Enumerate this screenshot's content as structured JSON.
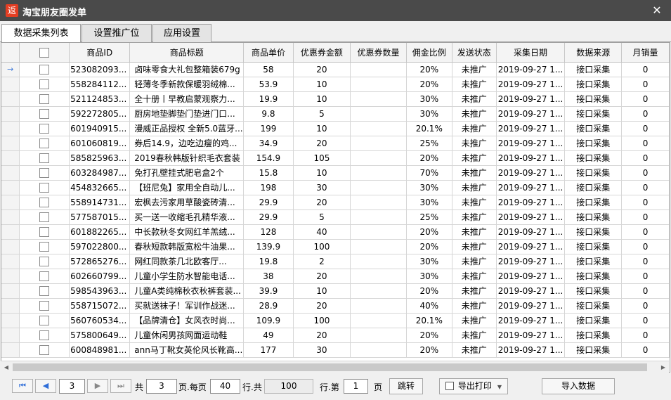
{
  "window": {
    "title": "淘宝朋友圈发单",
    "icon_text": "返",
    "close_symbol": "✕",
    "icon": "app-logo-icon"
  },
  "tabs": [
    {
      "label": "数据采集列表",
      "active": true
    },
    {
      "label": "设置推广位",
      "active": false
    },
    {
      "label": "应用设置",
      "active": false
    }
  ],
  "table": {
    "columns": [
      "商品ID",
      "商品标题",
      "商品单价",
      "优惠券金额",
      "优惠券数量",
      "佣金比例",
      "发送状态",
      "采集日期",
      "数据来源",
      "月销量"
    ],
    "current_row_marker": "→",
    "rows": [
      {
        "id": "523082093...",
        "title": "卤味零食大礼包整箱装679g",
        "price": "58",
        "coupon": "20",
        "coupon_count": "",
        "commission": "20%",
        "status": "未推广",
        "date": "2019-09-27 1...",
        "source": "接口采集",
        "sales": "0"
      },
      {
        "id": "558284112...",
        "title": "轻薄冬季新款保暖羽绒棉...",
        "price": "53.9",
        "coupon": "10",
        "coupon_count": "",
        "commission": "20%",
        "status": "未推广",
        "date": "2019-09-27 1...",
        "source": "接口采集",
        "sales": "0"
      },
      {
        "id": "521124853...",
        "title": "全十册丨早教启蒙观察力...",
        "price": "19.9",
        "coupon": "10",
        "coupon_count": "",
        "commission": "30%",
        "status": "未推广",
        "date": "2019-09-27 1...",
        "source": "接口采集",
        "sales": "0"
      },
      {
        "id": "592272805...",
        "title": "厨房地垫脚垫门垫进门口...",
        "price": "9.8",
        "coupon": "5",
        "coupon_count": "",
        "commission": "30%",
        "status": "未推广",
        "date": "2019-09-27 1...",
        "source": "接口采集",
        "sales": "0"
      },
      {
        "id": "601940915...",
        "title": "漫威正品授权 全新5.0蓝牙...",
        "price": "199",
        "coupon": "10",
        "coupon_count": "",
        "commission": "20.1%",
        "status": "未推广",
        "date": "2019-09-27 1...",
        "source": "接口采集",
        "sales": "0"
      },
      {
        "id": "601060819...",
        "title": "券后14.9，边吃边瘦的鸡...",
        "price": "34.9",
        "coupon": "20",
        "coupon_count": "",
        "commission": "25%",
        "status": "未推广",
        "date": "2019-09-27 1...",
        "source": "接口采集",
        "sales": "0"
      },
      {
        "id": "585825963...",
        "title": "2019春秋韩版针织毛衣套装",
        "price": "154.9",
        "coupon": "105",
        "coupon_count": "",
        "commission": "20%",
        "status": "未推广",
        "date": "2019-09-27 1...",
        "source": "接口采集",
        "sales": "0"
      },
      {
        "id": "603284987...",
        "title": "免打孔壁挂式肥皂盒2个",
        "price": "15.8",
        "coupon": "10",
        "coupon_count": "",
        "commission": "70%",
        "status": "未推广",
        "date": "2019-09-27 1...",
        "source": "接口采集",
        "sales": "0"
      },
      {
        "id": "454832665...",
        "title": "【班尼兔】家用全自动儿...",
        "price": "198",
        "coupon": "30",
        "coupon_count": "",
        "commission": "30%",
        "status": "未推广",
        "date": "2019-09-27 1...",
        "source": "接口采集",
        "sales": "0"
      },
      {
        "id": "558914731...",
        "title": "宏枫去污家用草酸瓷砖清...",
        "price": "29.9",
        "coupon": "20",
        "coupon_count": "",
        "commission": "30%",
        "status": "未推广",
        "date": "2019-09-27 1...",
        "source": "接口采集",
        "sales": "0"
      },
      {
        "id": "577587015...",
        "title": "买一送一收缩毛孔精华液...",
        "price": "29.9",
        "coupon": "5",
        "coupon_count": "",
        "commission": "25%",
        "status": "未推广",
        "date": "2019-09-27 1...",
        "source": "接口采集",
        "sales": "0"
      },
      {
        "id": "601882265...",
        "title": "中长款秋冬女网红羊羔绒...",
        "price": "128",
        "coupon": "40",
        "coupon_count": "",
        "commission": "20%",
        "status": "未推广",
        "date": "2019-09-27 1...",
        "source": "接口采集",
        "sales": "0"
      },
      {
        "id": "597022800...",
        "title": "春秋短款韩版宽松牛油果...",
        "price": "139.9",
        "coupon": "100",
        "coupon_count": "",
        "commission": "20%",
        "status": "未推广",
        "date": "2019-09-27 1...",
        "source": "接口采集",
        "sales": "0"
      },
      {
        "id": "572865276...",
        "title": "网红同款茶几北欧客厅...",
        "price": "19.8",
        "coupon": "2",
        "coupon_count": "",
        "commission": "30%",
        "status": "未推广",
        "date": "2019-09-27 1...",
        "source": "接口采集",
        "sales": "0"
      },
      {
        "id": "602660799...",
        "title": "儿童小学生防水智能电话...",
        "price": "38",
        "coupon": "20",
        "coupon_count": "",
        "commission": "30%",
        "status": "未推广",
        "date": "2019-09-27 1...",
        "source": "接口采集",
        "sales": "0"
      },
      {
        "id": "598543963...",
        "title": "儿童A类纯棉秋衣秋裤套装...",
        "price": "39.9",
        "coupon": "10",
        "coupon_count": "",
        "commission": "20%",
        "status": "未推广",
        "date": "2019-09-27 1...",
        "source": "接口采集",
        "sales": "0"
      },
      {
        "id": "558715072...",
        "title": "买就送袜子！军训作战迷...",
        "price": "28.9",
        "coupon": "20",
        "coupon_count": "",
        "commission": "40%",
        "status": "未推广",
        "date": "2019-09-27 1...",
        "source": "接口采集",
        "sales": "0"
      },
      {
        "id": "560760534...",
        "title": "【品牌清仓】女风衣时尚...",
        "price": "109.9",
        "coupon": "100",
        "coupon_count": "",
        "commission": "20.1%",
        "status": "未推广",
        "date": "2019-09-27 1...",
        "source": "接口采集",
        "sales": "0"
      },
      {
        "id": "575800649...",
        "title": "儿童休闲男孩网面运动鞋",
        "price": "49",
        "coupon": "20",
        "coupon_count": "",
        "commission": "20%",
        "status": "未推广",
        "date": "2019-09-27 1...",
        "source": "接口采集",
        "sales": "0"
      },
      {
        "id": "600848981...",
        "title": "ann马丁靴女英伦风长靴高...",
        "price": "177",
        "coupon": "30",
        "coupon_count": "",
        "commission": "20%",
        "status": "未推广",
        "date": "2019-09-27 1...",
        "source": "接口采集",
        "sales": "0"
      }
    ]
  },
  "pager": {
    "first_symbol": "⏮",
    "prev_symbol": "◀",
    "next_symbol": "▶",
    "last_symbol": "⏭",
    "current_page": "3",
    "total_label": "共",
    "total_pages": "3",
    "per_page_label": "页.每页",
    "per_page": "40",
    "rows_label": "行.共",
    "total_rows": "100",
    "goto_label": "行.第",
    "goto_page": "1",
    "page_label": "页",
    "jump_button": "跳转",
    "export_button": "导出打印",
    "import_button": "导入数据"
  },
  "colors": {
    "titlebar": "#4a4a4a",
    "app_icon": "#e43e23",
    "pager_accent": "#2f6ed8"
  }
}
